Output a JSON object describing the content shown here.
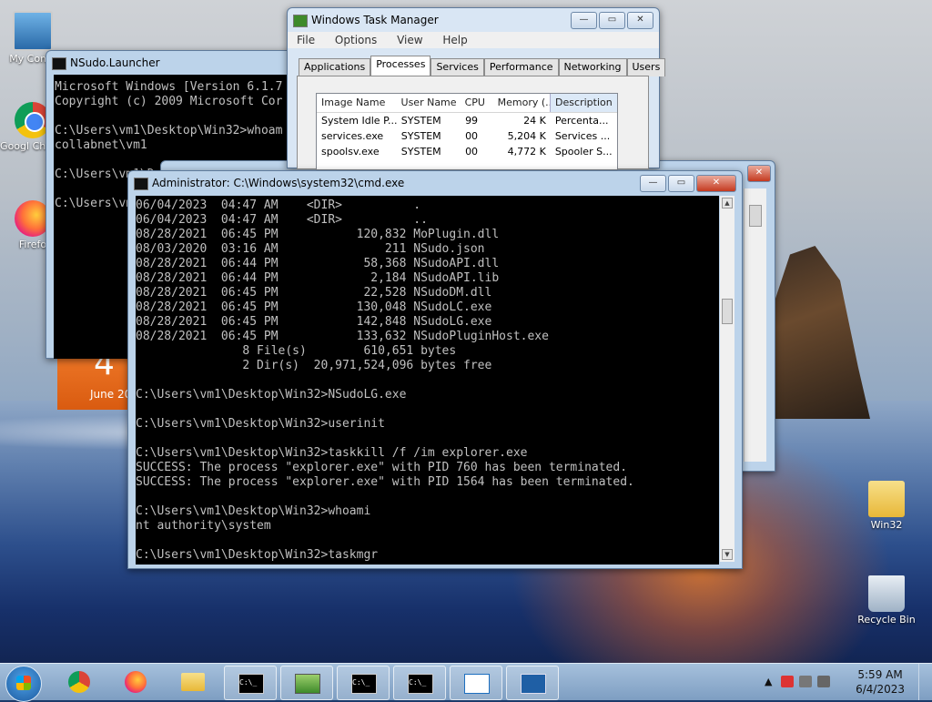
{
  "desktop": {
    "icons": [
      {
        "label": "My Comp"
      },
      {
        "label": "Googl Chrom"
      },
      {
        "label": "Firefo"
      },
      {
        "label": "Win32"
      },
      {
        "label": "Recycle Bin"
      }
    ],
    "gadget": {
      "day": "4",
      "month": "June 20"
    }
  },
  "nsudo_window": {
    "title": "NSudo.Launcher",
    "lines": [
      "Microsoft Windows [Version 6.1.7",
      "Copyright (c) 2009 Microsoft Cor",
      "",
      "C:\\Users\\vm1\\Desktop\\Win32>whoam",
      "collabnet\\vm1",
      "",
      "C:\\Users\\vm1\\Desktop\\Win32>useri",
      "",
      "C:\\Users\\vm1\\D"
    ]
  },
  "task_manager": {
    "title": "Windows Task Manager",
    "menu": [
      "File",
      "Options",
      "View",
      "Help"
    ],
    "tabs": [
      "Applications",
      "Processes",
      "Services",
      "Performance",
      "Networking",
      "Users"
    ],
    "active_tab": "Processes",
    "columns": [
      "Image Name",
      "User Name",
      "CPU",
      "Memory (...",
      "Description"
    ],
    "rows": [
      [
        "System Idle P...",
        "SYSTEM",
        "99",
        "24 K",
        "Percenta..."
      ],
      [
        "services.exe",
        "SYSTEM",
        "00",
        "5,204 K",
        "Services ..."
      ],
      [
        "spoolsv.exe",
        "SYSTEM",
        "00",
        "4,772 K",
        "Spooler S..."
      ]
    ]
  },
  "cmd_window": {
    "title": "Administrator: C:\\Windows\\system32\\cmd.exe",
    "lines": [
      "06/04/2023  04:47 AM    <DIR>          .",
      "06/04/2023  04:47 AM    <DIR>          ..",
      "08/28/2021  06:45 PM           120,832 MoPlugin.dll",
      "08/03/2020  03:16 AM               211 NSudo.json",
      "08/28/2021  06:44 PM            58,368 NSudoAPI.dll",
      "08/28/2021  06:44 PM             2,184 NSudoAPI.lib",
      "08/28/2021  06:45 PM            22,528 NSudoDM.dll",
      "08/28/2021  06:45 PM           130,048 NSudoLC.exe",
      "08/28/2021  06:45 PM           142,848 NSudoLG.exe",
      "08/28/2021  06:45 PM           133,632 NSudoPluginHost.exe",
      "               8 File(s)        610,651 bytes",
      "               2 Dir(s)  20,971,524,096 bytes free",
      "",
      "C:\\Users\\vm1\\Desktop\\Win32>NSudoLG.exe",
      "",
      "C:\\Users\\vm1\\Desktop\\Win32>userinit",
      "",
      "C:\\Users\\vm1\\Desktop\\Win32>taskkill /f /im explorer.exe",
      "SUCCESS: The process \"explorer.exe\" with PID 760 has been terminated.",
      "SUCCESS: The process \"explorer.exe\" with PID 1564 has been terminated.",
      "",
      "C:\\Users\\vm1\\Desktop\\Win32>whoami",
      "nt authority\\system",
      "",
      "C:\\Users\\vm1\\Desktop\\Win32>taskmgr"
    ]
  },
  "window_controls": {
    "minimize": "—",
    "maximize": "▭",
    "close": "✕"
  },
  "taskbar": {
    "cmd_glyph": "C:\\_",
    "clock_time": "5:59 AM",
    "clock_date": "6/4/2023",
    "tray_arrow": "▲"
  }
}
